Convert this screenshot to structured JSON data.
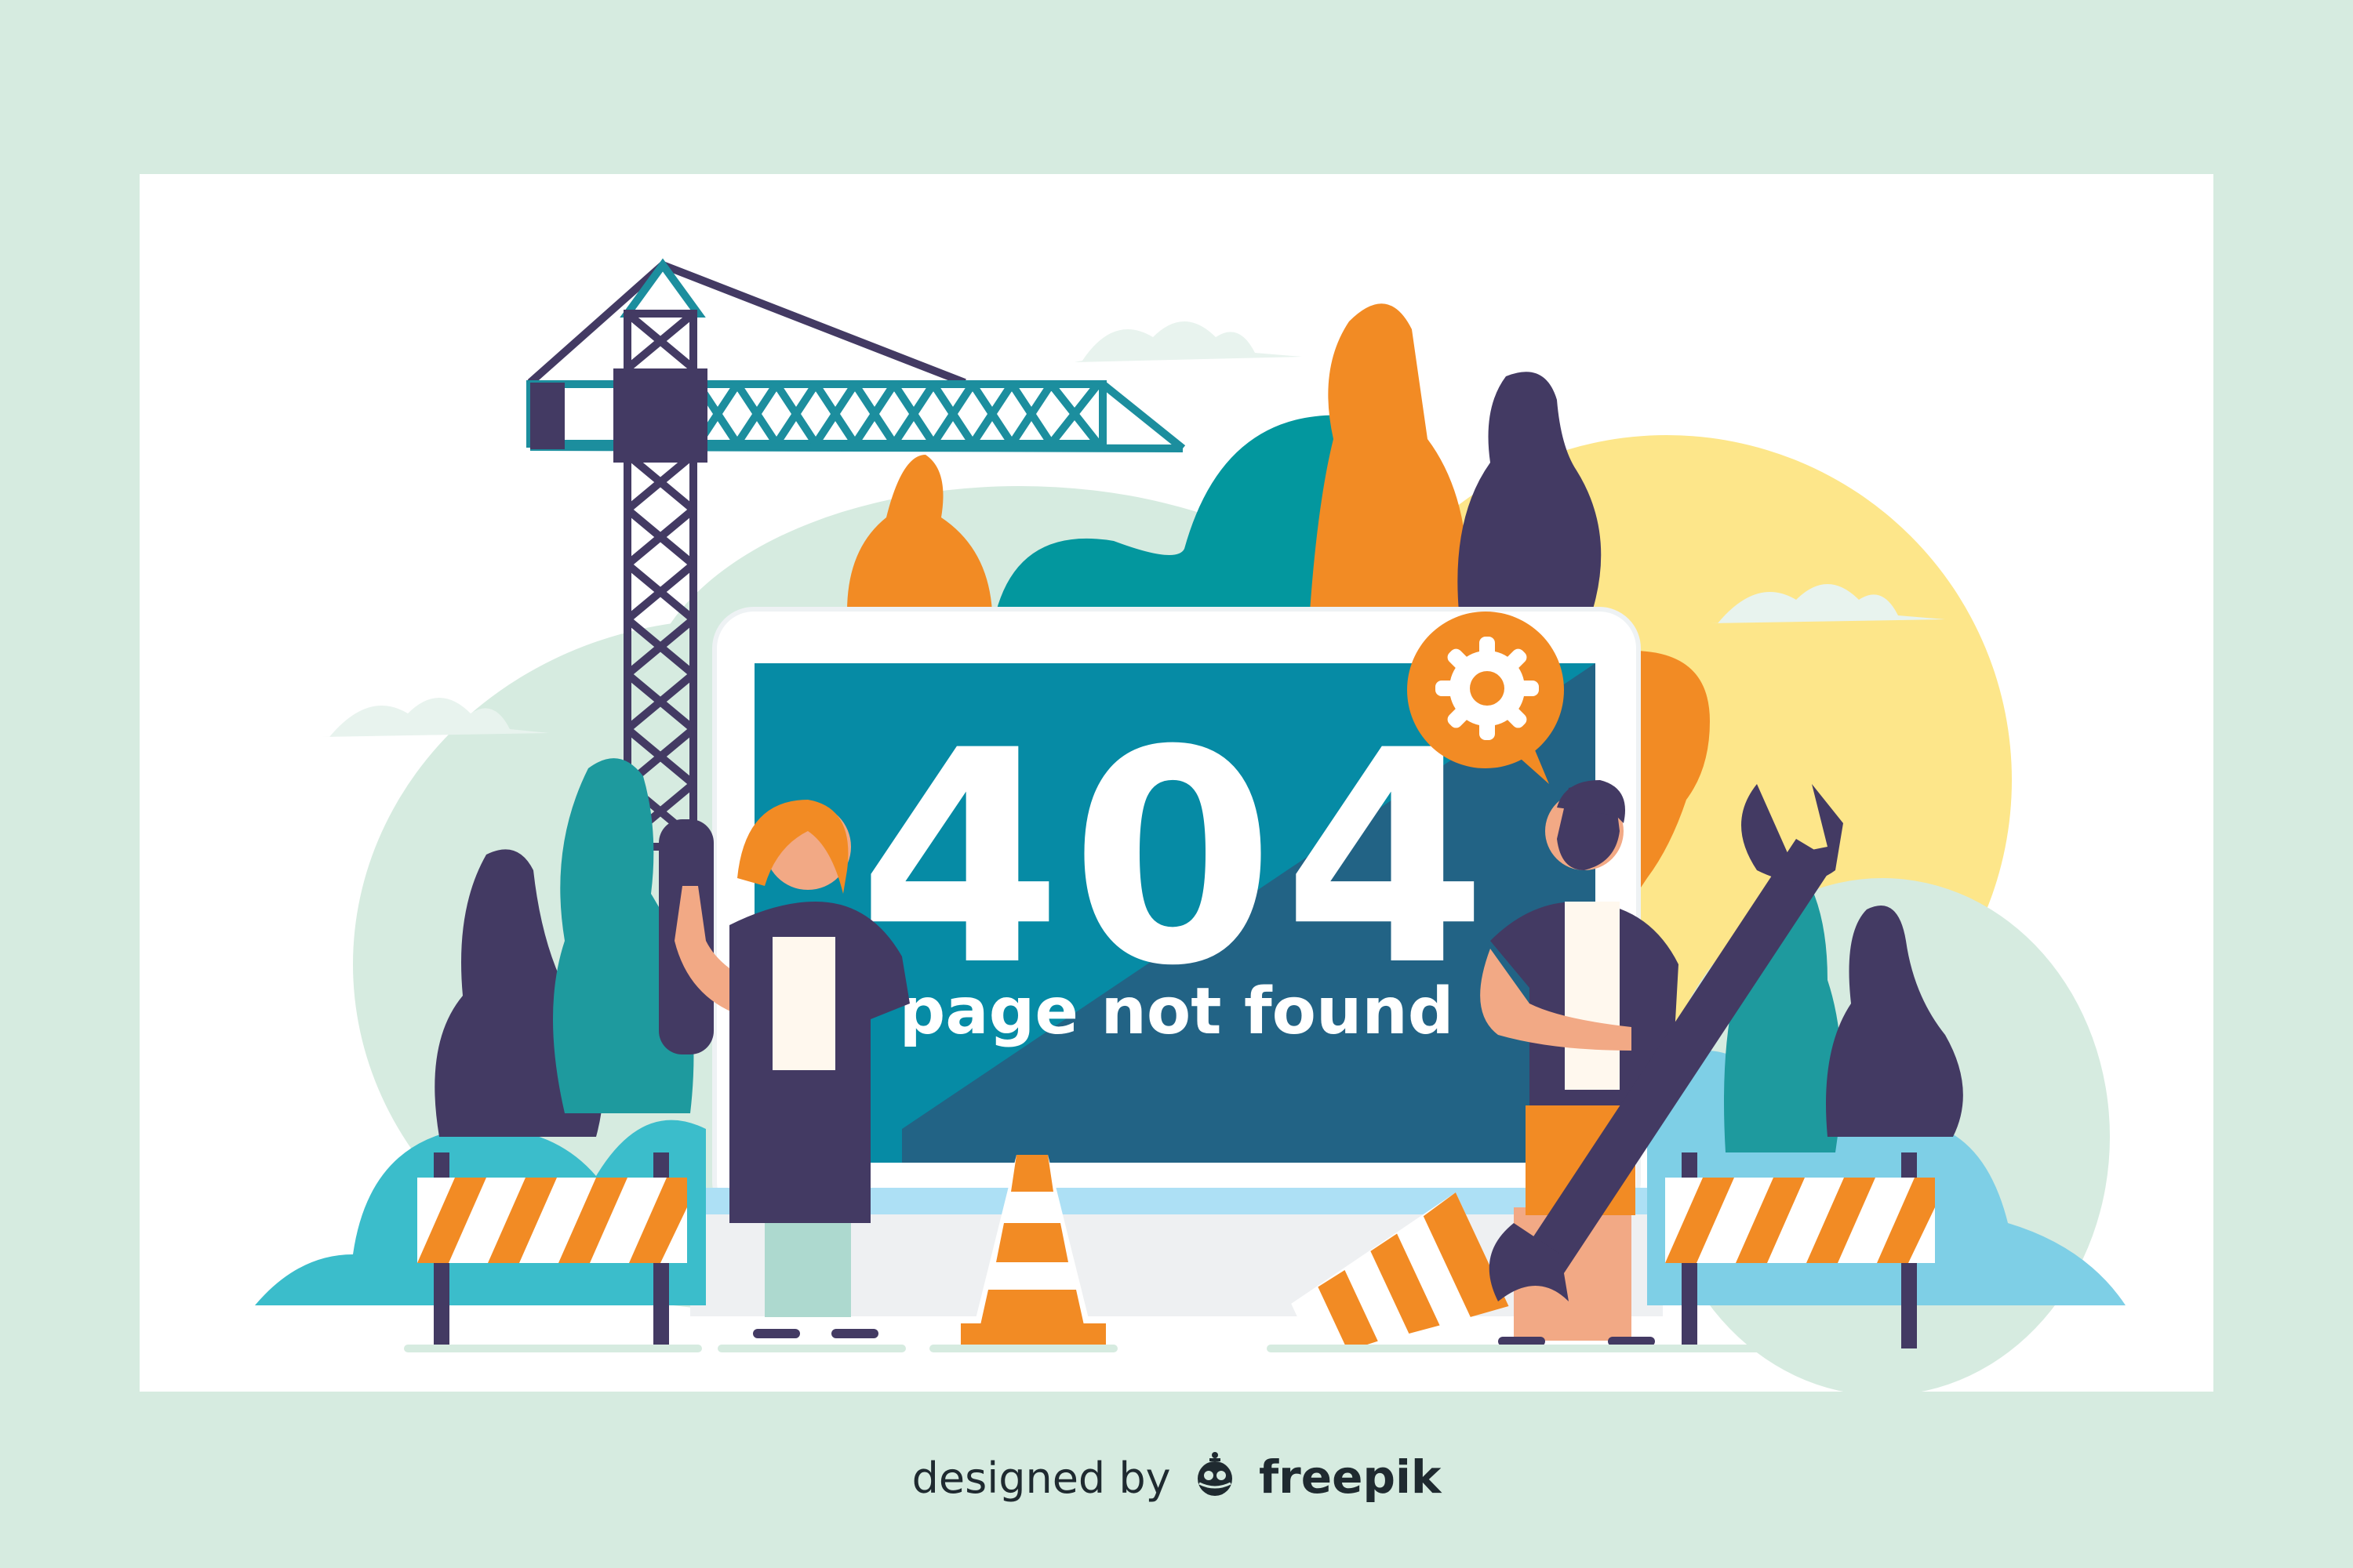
{
  "error": {
    "code": "404",
    "message": "page not found"
  },
  "footer": {
    "prefix": "designed by",
    "brand": "freepik",
    "logo_icon": "freepik-robot-logo-icon"
  },
  "colors": {
    "background": "#d6ebe0",
    "card": "#ffffff",
    "screen_top": "#068ba5",
    "screen_bottom": "#226385",
    "orange": "#f28b24",
    "navy": "#433a63",
    "teal": "#03979e",
    "sun": "#fde68a"
  }
}
